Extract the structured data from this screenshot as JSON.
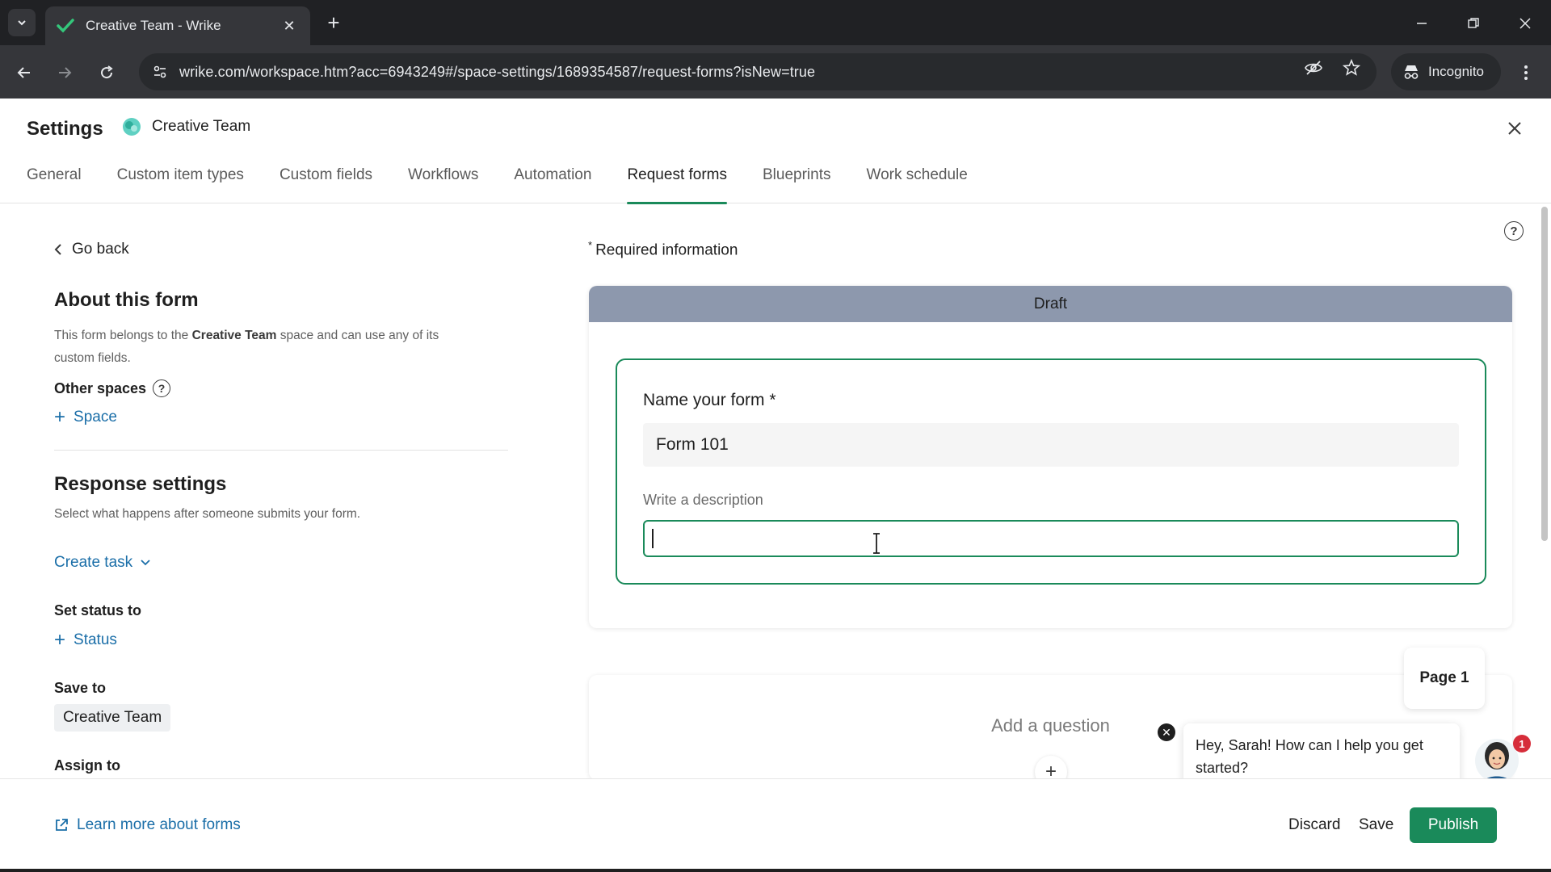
{
  "browser": {
    "tab_title": "Creative Team - Wrike",
    "url": "wrike.com/workspace.htm?acc=6943249#/space-settings/1689354587/request-forms?isNew=true",
    "incognito_label": "Incognito"
  },
  "header": {
    "title": "Settings",
    "space_name": "Creative Team",
    "tabs": [
      {
        "label": "General",
        "active": false
      },
      {
        "label": "Custom item types",
        "active": false
      },
      {
        "label": "Custom fields",
        "active": false
      },
      {
        "label": "Workflows",
        "active": false
      },
      {
        "label": "Automation",
        "active": false
      },
      {
        "label": "Request forms",
        "active": true
      },
      {
        "label": "Blueprints",
        "active": false
      },
      {
        "label": "Work schedule",
        "active": false
      }
    ]
  },
  "left_panel": {
    "go_back": "Go back",
    "about_title": "About this form",
    "about_text_prefix": "This form belongs to the ",
    "about_text_space": "Creative Team",
    "about_text_suffix": " space and can use any of its custom fields.",
    "other_spaces_label": "Other spaces",
    "add_space_label": "Space",
    "response_settings_title": "Response settings",
    "response_settings_desc": "Select what happens after someone submits your form.",
    "create_task_label": "Create task",
    "set_status_label": "Set status to",
    "add_status_label": "Status",
    "save_to_label": "Save to",
    "save_to_value": "Creative Team",
    "assign_to_label": "Assign to"
  },
  "main": {
    "required_info": "Required information",
    "draft_label": "Draft",
    "name_label": "Name your form *",
    "name_value": "Form 101",
    "description_label": "Write a description",
    "description_value": "",
    "add_question_label": "Add a question",
    "page_badge": "Page 1"
  },
  "chat": {
    "message": "Hey, Sarah! How can I help you get started?",
    "badge_count": "1"
  },
  "footer": {
    "learn_more": "Learn more about forms",
    "discard": "Discard",
    "save": "Save",
    "publish": "Publish"
  },
  "colors": {
    "accent_green": "#1a8a5a",
    "link_blue": "#1a6ea8",
    "draft_bar": "#8d98ad"
  }
}
